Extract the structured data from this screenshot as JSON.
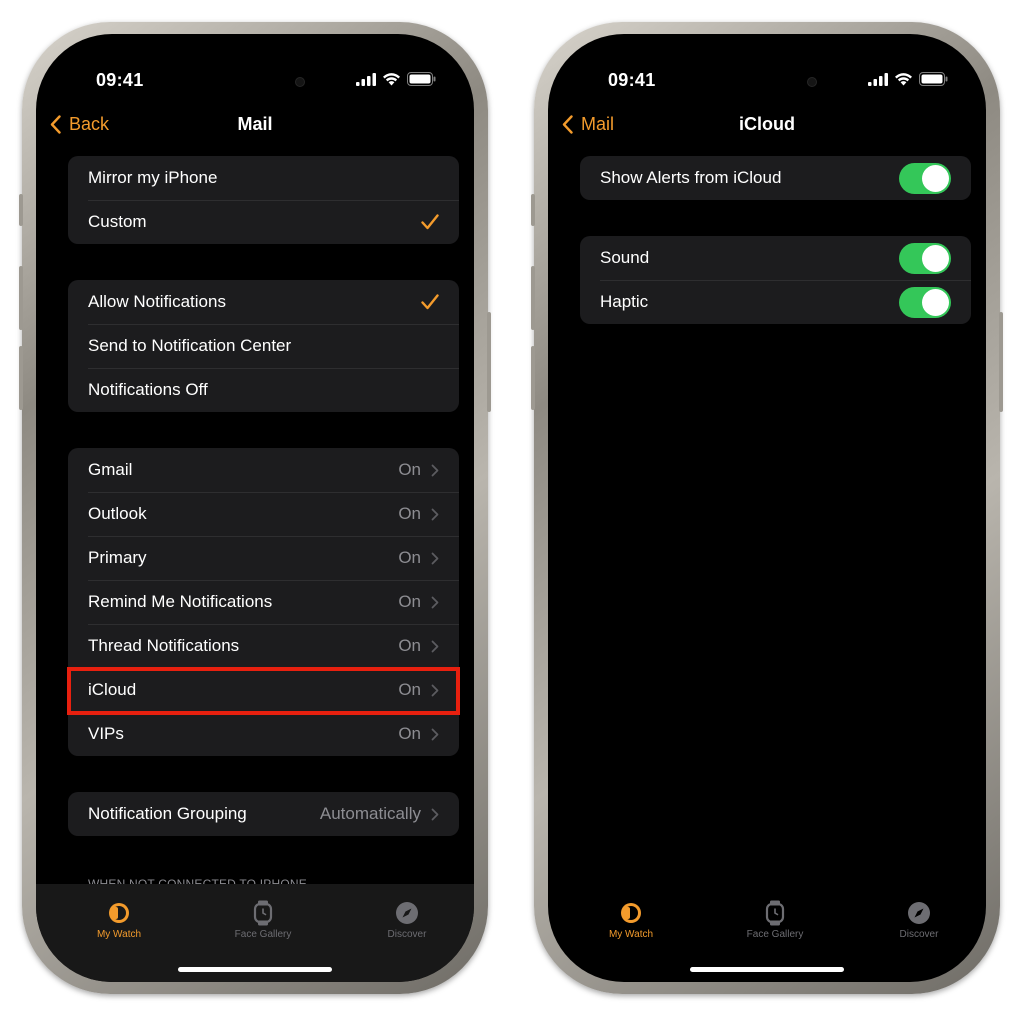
{
  "colors": {
    "accent": "#f39b2c",
    "toggle_on": "#34c759",
    "highlight": "#e8200f",
    "group_bg": "#1c1c1e",
    "secondary_text": "#8d8d92"
  },
  "left": {
    "status": {
      "time": "09:41"
    },
    "nav": {
      "back_label": "Back",
      "title": "Mail"
    },
    "mirror_group": [
      {
        "label": "Mirror my iPhone",
        "checked": false
      },
      {
        "label": "Custom",
        "checked": true
      }
    ],
    "notif_group": [
      {
        "label": "Allow Notifications",
        "checked": true
      },
      {
        "label": "Send to Notification Center",
        "checked": false
      },
      {
        "label": "Notifications Off",
        "checked": false
      }
    ],
    "accounts": [
      {
        "label": "Gmail",
        "value": "On"
      },
      {
        "label": "Outlook",
        "value": "On"
      },
      {
        "label": "Primary",
        "value": "On"
      },
      {
        "label": "Remind Me Notifications",
        "value": "On"
      },
      {
        "label": "Thread Notifications",
        "value": "On"
      },
      {
        "label": "iCloud",
        "value": "On",
        "highlighted": true
      },
      {
        "label": "VIPs",
        "value": "On"
      }
    ],
    "grouping": {
      "label": "Notification Grouping",
      "value": "Automatically"
    },
    "footer_header": "WHEN NOT CONNECTED TO IPHONE"
  },
  "right": {
    "status": {
      "time": "09:41"
    },
    "nav": {
      "back_label": "Mail",
      "title": "iCloud"
    },
    "alerts_group": [
      {
        "label": "Show Alerts from iCloud",
        "on": true
      }
    ],
    "feedback_group": [
      {
        "label": "Sound",
        "on": true
      },
      {
        "label": "Haptic",
        "on": true
      }
    ]
  },
  "tabs": [
    {
      "label": "My Watch",
      "icon": "my-watch-icon",
      "active": true
    },
    {
      "label": "Face Gallery",
      "icon": "watch-face-icon",
      "active": false
    },
    {
      "label": "Discover",
      "icon": "compass-icon",
      "active": false
    }
  ]
}
